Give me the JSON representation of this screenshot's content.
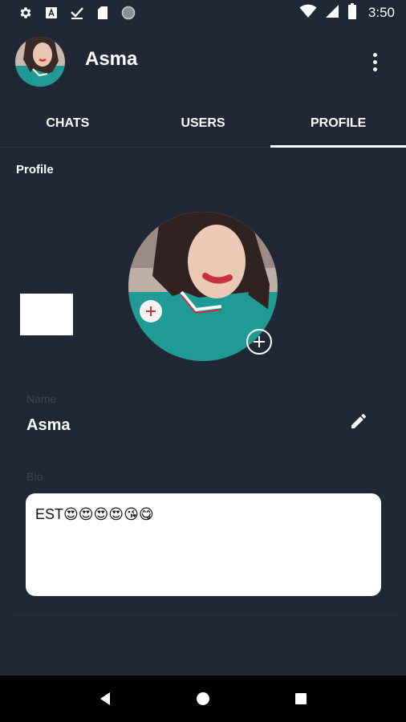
{
  "status_bar": {
    "time": "3:50",
    "left_icons": [
      "settings-icon",
      "translate-icon",
      "download-done-icon",
      "sd-card-icon",
      "circle-icon"
    ],
    "right_icons": [
      "wifi-icon",
      "cell-signal-icon",
      "battery-icon"
    ]
  },
  "app_bar": {
    "title": "Asma",
    "menu_icon": "more-vert-icon"
  },
  "tabs": [
    {
      "label": "CHATS",
      "active": false
    },
    {
      "label": "USERS",
      "active": false
    },
    {
      "label": "PROFILE",
      "active": true
    }
  ],
  "profile": {
    "section_title": "Profile",
    "name_label": "Name",
    "name_value": "Asma",
    "bio_label": "Bio",
    "bio_value": "EST😍😍😍😍😘😋"
  },
  "nav_bar": {
    "icons": [
      "back-icon",
      "home-icon",
      "recents-icon"
    ]
  },
  "colors": {
    "background": "#212835",
    "accent": "#ffffff",
    "label_muted": "#3c4555"
  }
}
